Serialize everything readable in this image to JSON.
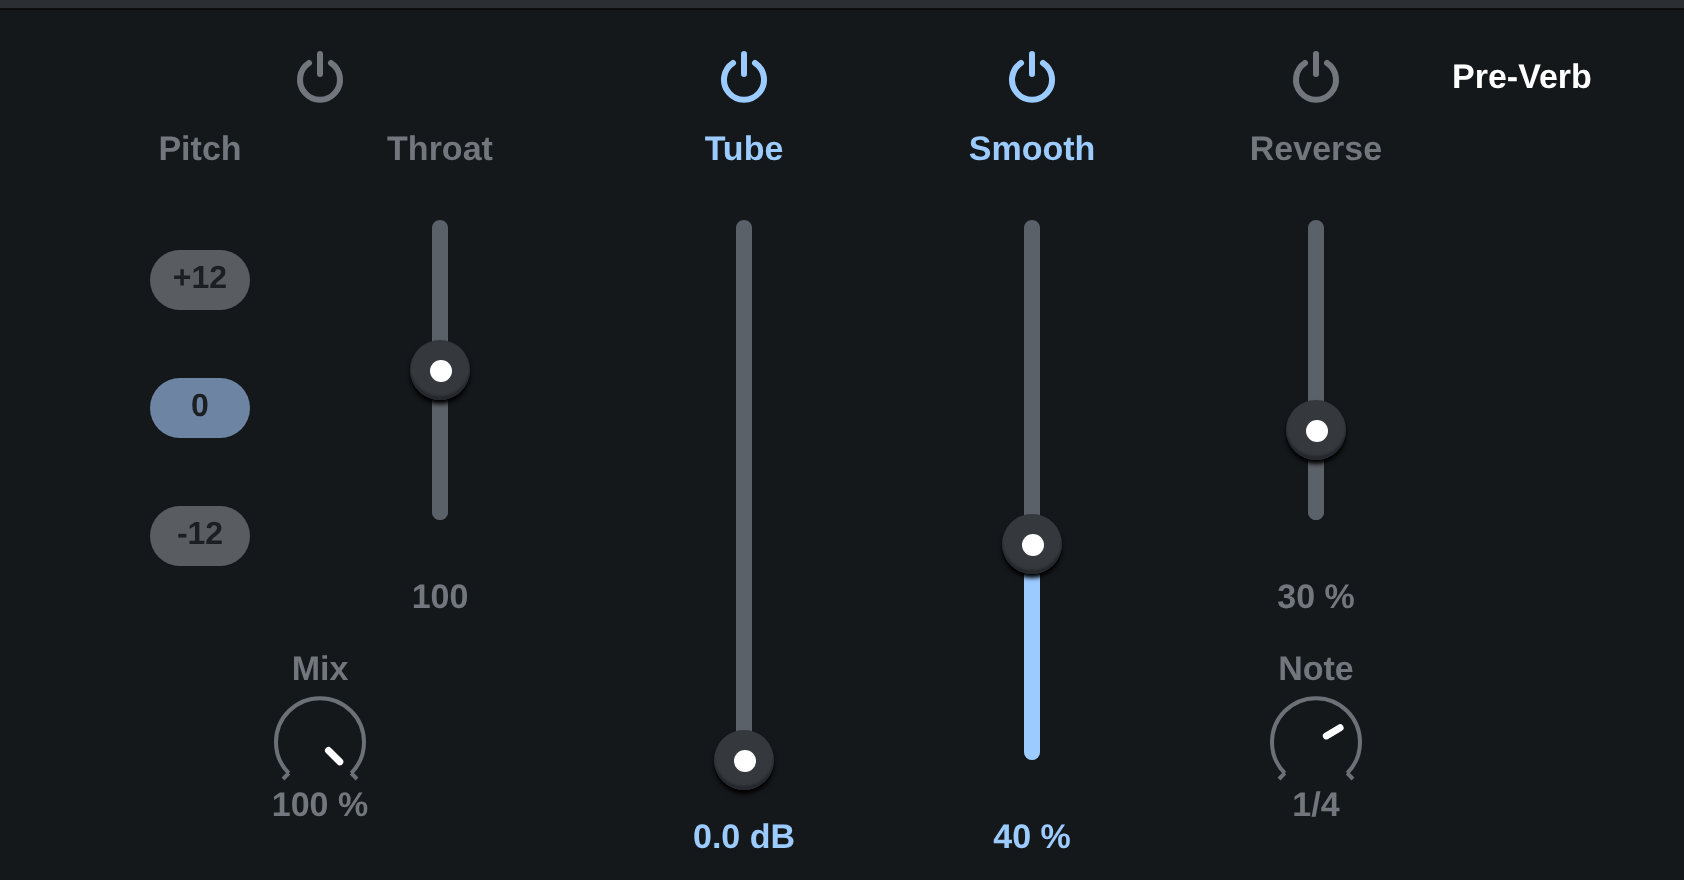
{
  "title": "Pre-Verb",
  "sections": [
    {
      "power_on": false,
      "columns": [
        {
          "kind": "buttons",
          "label": "Pitch",
          "buttons": [
            {
              "label": "+12",
              "selected": false
            },
            {
              "label": "0",
              "selected": true
            },
            {
              "label": "-12",
              "selected": false
            }
          ]
        },
        {
          "kind": "slider",
          "label": "Throat",
          "level": 0.5,
          "reading": "100"
        }
      ],
      "knob": {
        "label": "Mix",
        "reading": "100 %"
      }
    },
    {
      "power_on": true,
      "columns": [
        {
          "kind": "slider",
          "label": "Tube",
          "reading": "0.0 dB"
        }
      ]
    },
    {
      "power_on": true,
      "columns": [
        {
          "kind": "slider",
          "label": "Smooth",
          "level": 0.4,
          "reading": "40 %"
        }
      ]
    },
    {
      "power_on": false,
      "columns": [
        {
          "kind": "slider",
          "label": "Reverse",
          "level": 0.3,
          "reading": "30 %"
        }
      ],
      "knob": {
        "label": "Note",
        "reading": "1/4"
      }
    }
  ]
}
